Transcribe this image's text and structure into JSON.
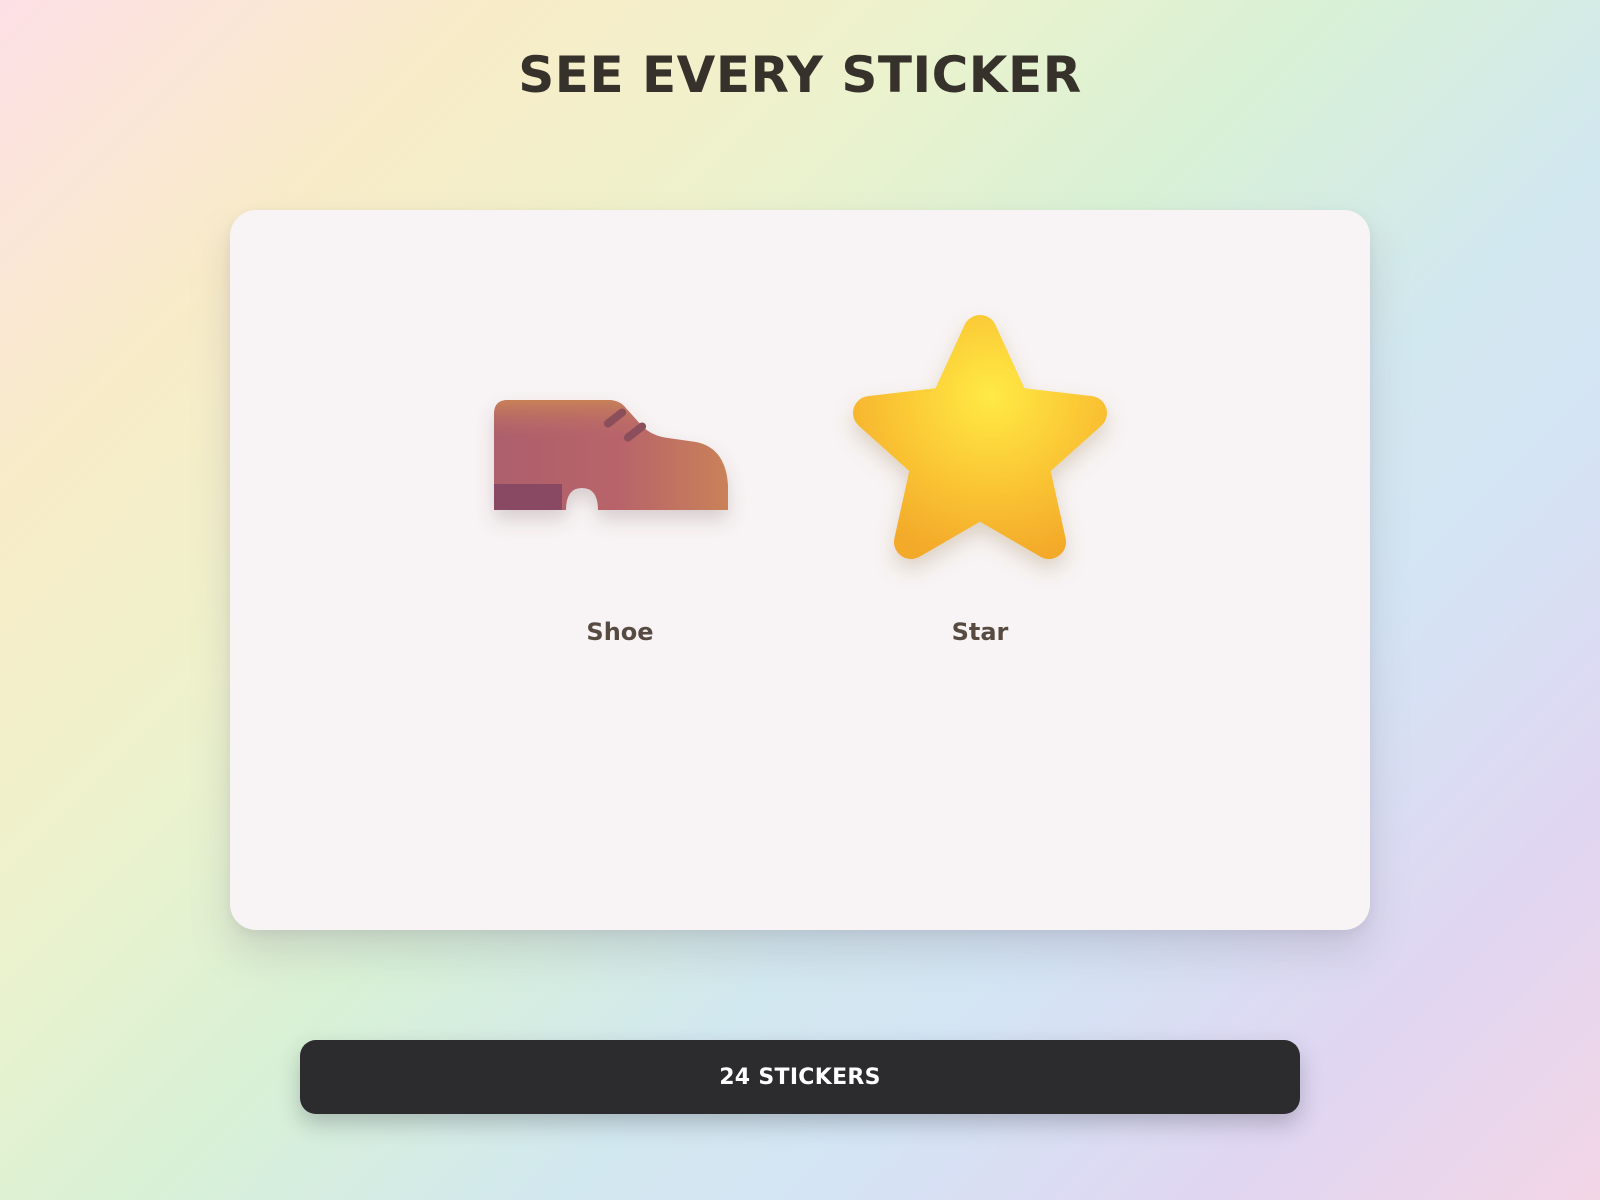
{
  "page": {
    "title": "SEE EVERY STICKER"
  },
  "stickers": [
    {
      "label": "Shoe",
      "icon": "shoe-icon"
    },
    {
      "label": "Star",
      "icon": "star-icon"
    }
  ],
  "footer": {
    "count_label": "24 STICKERS"
  },
  "colors": {
    "title_text": "#37312c",
    "card_background": "#f8f4f5",
    "label_text": "#574a40",
    "button_background": "#2c2b2e",
    "button_text": "#ffffff",
    "shoe_upper": "#b9646a",
    "shoe_heel": "#8a4a62",
    "star_fill": "#fbc733"
  }
}
